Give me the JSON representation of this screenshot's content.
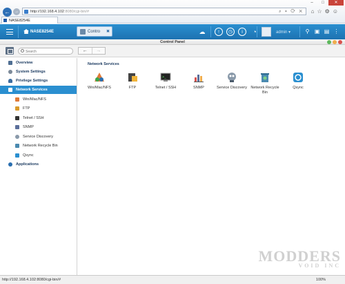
{
  "browser": {
    "url_host": "http://192.168.4.102",
    "url_rest": ":8080/cgi-bin/#",
    "tab_title": "NASE8254E",
    "status_url": "http://192.168.4.102:8080/cgi-bin/#",
    "zoom": "100%"
  },
  "topbar": {
    "nas_name": "NASE8254E",
    "app_tab": "Contro",
    "username": "admin"
  },
  "window": {
    "title": "Control Panel"
  },
  "toolbar": {
    "search_placeholder": "Search"
  },
  "sidebar": {
    "items": [
      {
        "label": "Overview",
        "level": "main"
      },
      {
        "label": "System Settings",
        "level": "main"
      },
      {
        "label": "Privilege Settings",
        "level": "main"
      },
      {
        "label": "Network Services",
        "level": "main",
        "active": true
      },
      {
        "label": "Win/Mac/NFS",
        "level": "sub"
      },
      {
        "label": "FTP",
        "level": "sub"
      },
      {
        "label": "Telnet / SSH",
        "level": "sub"
      },
      {
        "label": "SNMP",
        "level": "sub"
      },
      {
        "label": "Service Discovery",
        "level": "sub"
      },
      {
        "label": "Network Recycle Bin",
        "level": "sub"
      },
      {
        "label": "Qsync",
        "level": "sub"
      },
      {
        "label": "Applications",
        "level": "main"
      }
    ]
  },
  "content": {
    "section_title": "Network Services",
    "apps": [
      {
        "label": "Win/Mac/NFS"
      },
      {
        "label": "FTP"
      },
      {
        "label": "Telnet / SSH"
      },
      {
        "label": "SNMP"
      },
      {
        "label": "Service Discovery"
      },
      {
        "label": "Network Recycle Bin"
      },
      {
        "label": "Qsync"
      }
    ]
  },
  "colors": {
    "accent": "#2a8fd0",
    "topbar": "#1d72b1",
    "active_item": "#2a8fd0"
  },
  "watermark": {
    "main": "MODDERS",
    "sub": "VOID INC"
  }
}
